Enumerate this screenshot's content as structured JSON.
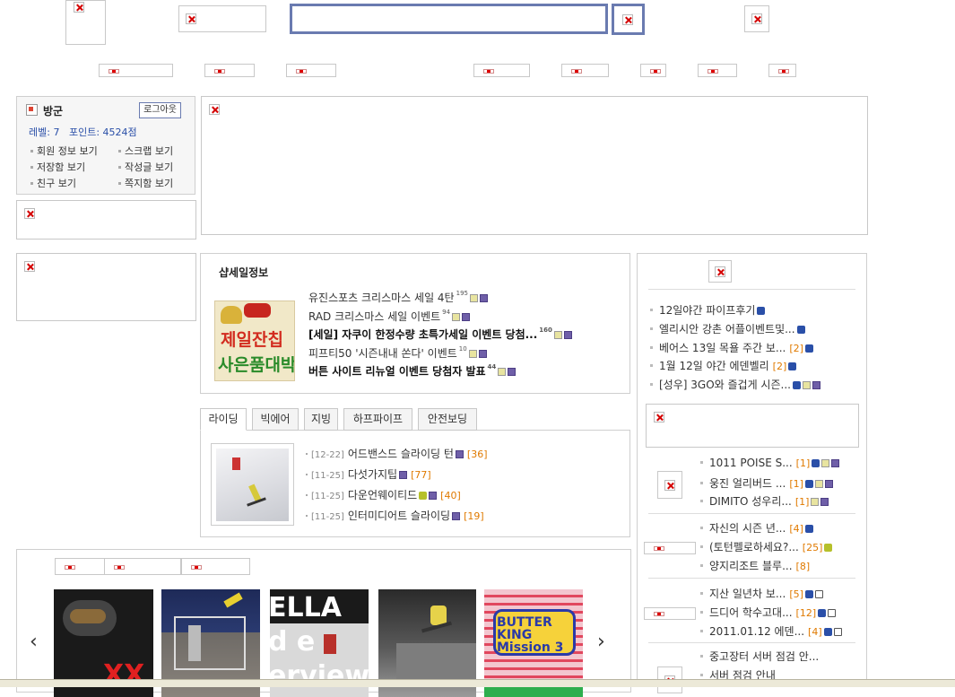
{
  "login": {
    "username": "방군",
    "logout_label": "로그아웃",
    "level_label": "레벨: 7",
    "points_label": "포인트: 4524점",
    "links": [
      "회원 정보 보기",
      "스크랩 보기",
      "저장함 보기",
      "작성글 보기",
      "친구 보기",
      "쪽지함 보기"
    ]
  },
  "shop_sale": {
    "title": "샵세일정보",
    "banner_line1": "제일잔칩",
    "banner_line2": "사은품대박",
    "items": [
      {
        "text": "유진스포츠 크리스마스 세일 4탄",
        "count": "195",
        "bold": false
      },
      {
        "text": "RAD 크리스마스 세일 이벤트",
        "count": "94",
        "bold": false
      },
      {
        "text": "[세일] 자쿠이 한정수량 초특가세일 이벤트 당첨...",
        "count": "160",
        "bold": true
      },
      {
        "text": "피프티50 '시즌내내 쏜다' 이벤트",
        "count": "10",
        "bold": false
      },
      {
        "text": "버튼 사이트 리뉴얼 이벤트 당첨자 발표",
        "count": "44",
        "bold": true
      }
    ]
  },
  "tabs": [
    "라이딩",
    "빅에어",
    "지빙",
    "하프파이프",
    "안전보딩"
  ],
  "riding_posts": [
    {
      "date": "[12-22]",
      "title": "어드밴스드 슬라이딩 턴",
      "comments": "[36]"
    },
    {
      "date": "[11-25]",
      "title": "다섯가지팁",
      "comments": "[77]"
    },
    {
      "date": "[11-25]",
      "title": "다운언웨이티드",
      "comments": "[40]"
    },
    {
      "date": "[11-25]",
      "title": "인터미디어트 슬라이딩",
      "comments": "[19]"
    }
  ],
  "right_list_1": [
    {
      "title": "12일야간 파이프후기",
      "comments": ""
    },
    {
      "title": "엘리시안 강촌 어플이벤트및...",
      "comments": ""
    },
    {
      "title": "베어스 13일 목욜 주간 보...",
      "comments": "[2]"
    },
    {
      "title": "1월 12일 야간 에덴벨리",
      "comments": "[2]"
    },
    {
      "title": "[성우] 3GO와 즐겁게 시즌...",
      "comments": ""
    }
  ],
  "right_list_2": [
    {
      "title": "1011 POISE S...",
      "comments": "[1]"
    },
    {
      "title": "웅진 얼리버드 ...",
      "comments": "[1]"
    },
    {
      "title": "DIMITO 성우리...",
      "comments": "[1]"
    }
  ],
  "right_list_3": [
    {
      "title": "자신의 시즌 년...",
      "comments": "[4]"
    },
    {
      "title": "(토턴펠로하세요?...",
      "comments": "[25]"
    },
    {
      "title": "양지리조트 블루...",
      "comments": "[8]"
    }
  ],
  "right_list_4": [
    {
      "title": "지산 일년차 보...",
      "comments": "[5]"
    },
    {
      "title": "드디어 학수고대...",
      "comments": "[12]"
    },
    {
      "title": "2011.01.12 에덴...",
      "comments": "[4]"
    }
  ],
  "right_list_5": [
    {
      "title": "중고장터 서버 점검 안..."
    },
    {
      "title": "서버 점검 안내"
    }
  ],
  "gallery": {
    "prev": "‹",
    "next": "›",
    "thumbs": [
      {
        "name": "goggle-rider-photo",
        "label": "XX"
      },
      {
        "name": "ruined-house-photo",
        "label": ""
      },
      {
        "name": "ella-poster-photo",
        "label": "ELLA d e erview"
      },
      {
        "name": "rail-jump-photo",
        "label": ""
      },
      {
        "name": "butter-king-poster",
        "label": "BUTTER KING Mission 3"
      }
    ]
  },
  "colors": {
    "accent_blue": "#2a4fa8",
    "orange": "#e07a00",
    "search_border": "#6a7bb0"
  }
}
